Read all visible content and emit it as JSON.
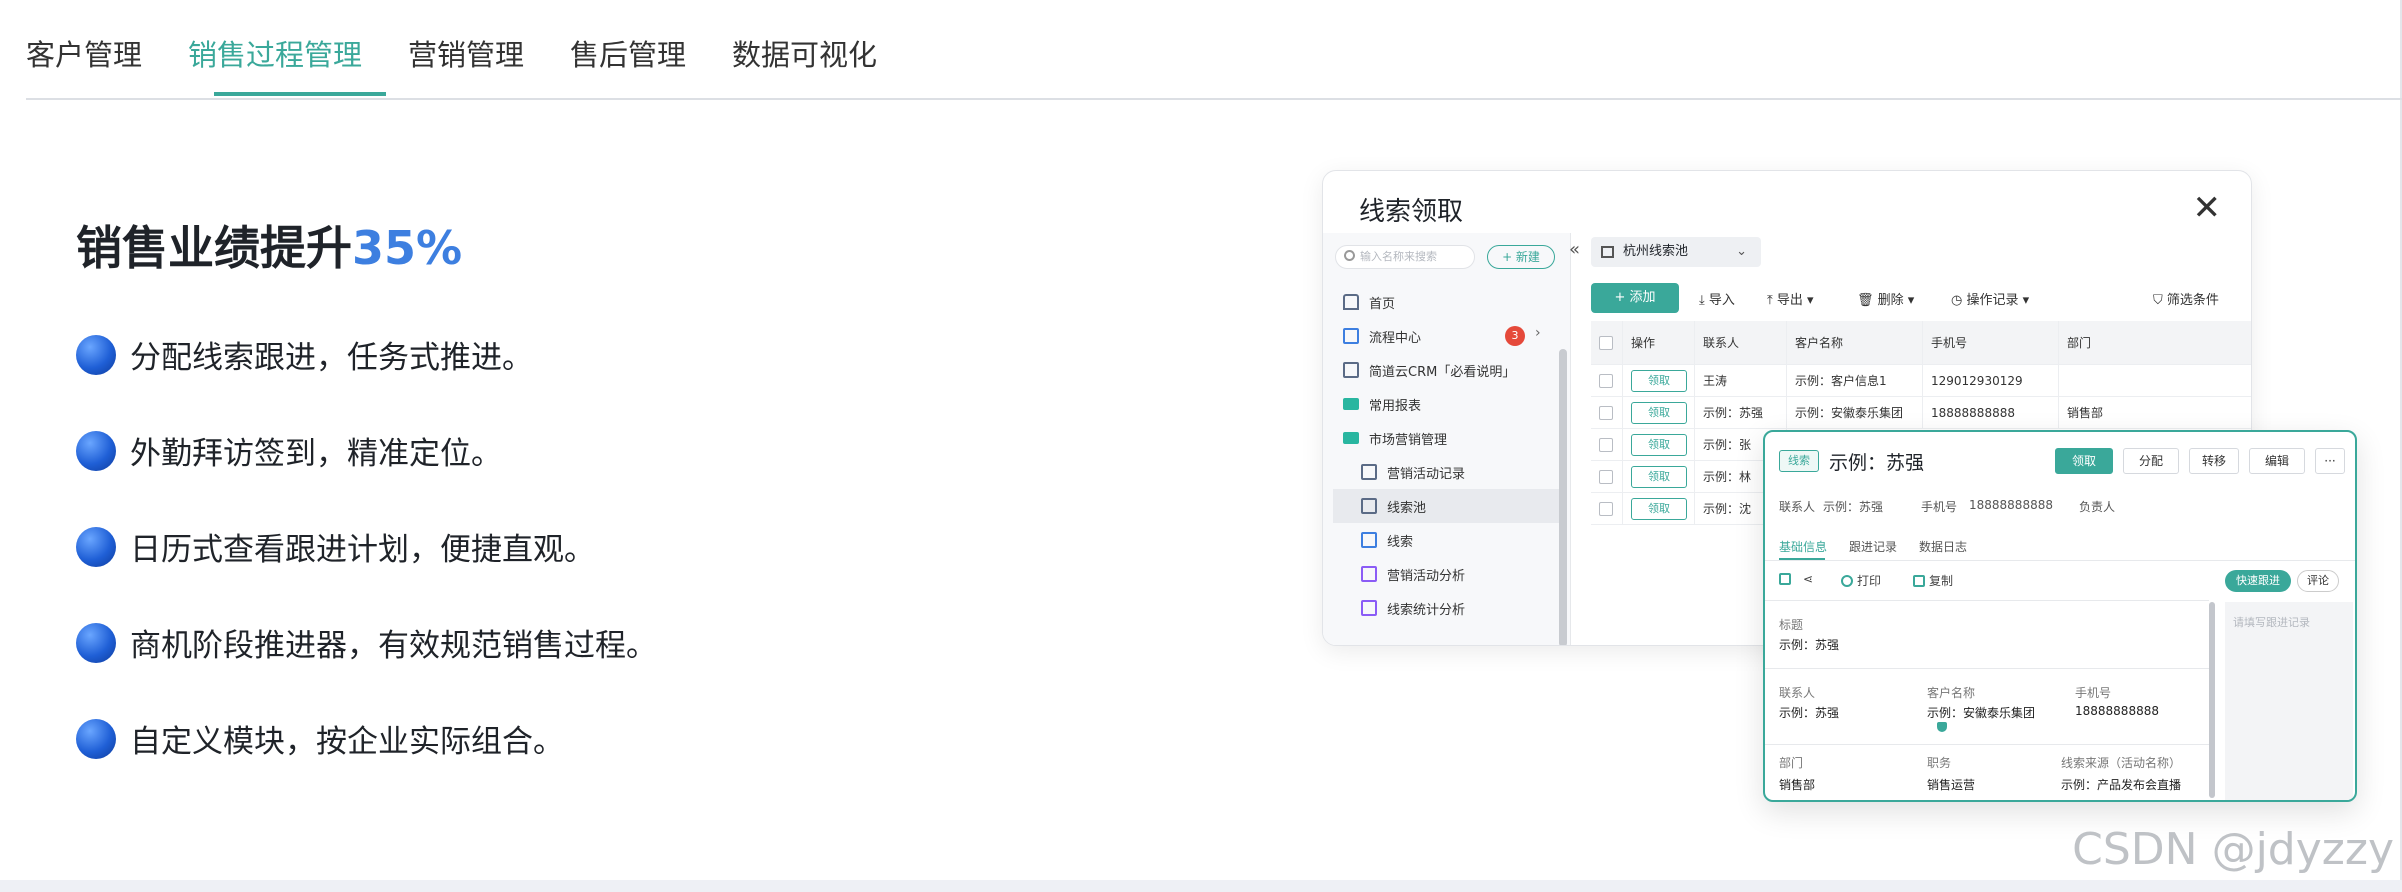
{
  "nav": {
    "tabs": [
      "客户管理",
      "销售过程管理",
      "营销管理",
      "售后管理",
      "数据可视化"
    ],
    "active_index": 1
  },
  "hero": {
    "headline_prefix": "销售业绩提升",
    "headline_highlight": "35%",
    "features": [
      "分配线索跟进，任务式推进。",
      "外勤拜访签到，精准定位。",
      "日历式查看跟进计划，便捷直观。",
      "商机阶段推进器，有效规范销售过程。",
      "自定义模块，按企业实际组合。"
    ]
  },
  "window": {
    "title": "线索领取",
    "close": "✕",
    "search_placeholder": "输入名称来搜索",
    "new_label": "+ 新建",
    "collapse": "«",
    "sidebar": [
      {
        "label": "首页",
        "icon": "home-icon"
      },
      {
        "label": "流程中心",
        "icon": "flow-icon",
        "badge": "3"
      },
      {
        "label": "简道云CRM「必看说明」",
        "icon": "doc-icon"
      },
      {
        "label": "常用报表",
        "icon": "folder-icon"
      },
      {
        "label": "市场营销管理",
        "icon": "folder-icon"
      },
      {
        "label": "营销活动记录",
        "icon": "doc-icon",
        "sub": true
      },
      {
        "label": "线索池",
        "icon": "doc-icon",
        "sub": true,
        "active": true
      },
      {
        "label": "线索",
        "icon": "line-icon",
        "sub": true
      },
      {
        "label": "营销活动分析",
        "icon": "chart-icon",
        "sub": true
      },
      {
        "label": "线索统计分析",
        "icon": "chart-icon",
        "sub": true
      }
    ],
    "pool_selector": "杭州线索池",
    "toolbar": {
      "add": "+ 添加",
      "import": "导入",
      "export": "导出",
      "delete": "删除",
      "history": "操作记录",
      "filter": "筛选条件"
    },
    "table": {
      "headers": [
        "操作",
        "联系人",
        "客户名称",
        "手机号",
        "部门"
      ],
      "claim_label": "领取",
      "rows": [
        [
          "王涛",
          "示例：客户信息1",
          "129012930129",
          ""
        ],
        [
          "示例：苏强",
          "示例：安徽泰乐集团",
          "18888888888",
          "销售部"
        ],
        [
          "示例：张",
          "",
          "",
          ""
        ],
        [
          "示例：林",
          "",
          "",
          ""
        ],
        [
          "示例：沈",
          "",
          "",
          ""
        ]
      ]
    }
  },
  "detail": {
    "tag": "线索",
    "title": "示例：苏强",
    "buttons": [
      "领取",
      "分配",
      "转移",
      "编辑",
      "···"
    ],
    "meta": {
      "contact_label": "联系人",
      "contact": "示例：苏强",
      "phone_label": "手机号",
      "phone": "18888888888",
      "owner_label": "负责人"
    },
    "tabs": [
      "基础信息",
      "跟进记录",
      "数据日志"
    ],
    "tools": {
      "print": "打印",
      "copy": "复制"
    },
    "quick_follow": "快速跟进",
    "comment": "评论",
    "note_placeholder": "请填写跟进记录",
    "fields": {
      "title_label": "标题",
      "title_val": "示例：苏强",
      "contact_label": "联系人",
      "contact_val": "示例：苏强",
      "customer_label": "客户名称",
      "customer_val": "示例：安徽泰乐集团",
      "phone_label": "手机号",
      "phone_val": "18888888888",
      "dept_label": "部门",
      "dept_val": "销售部",
      "job_label": "职务",
      "job_val": "销售运营",
      "source_label": "线索来源（活动名称）",
      "source_val": "示例：产品发布会直播"
    }
  },
  "watermark": "CSDN @jdyzzy",
  "colors": {
    "accent": "#3aa89a",
    "highlight": "#3d7fe0",
    "badge": "#e5493a"
  }
}
